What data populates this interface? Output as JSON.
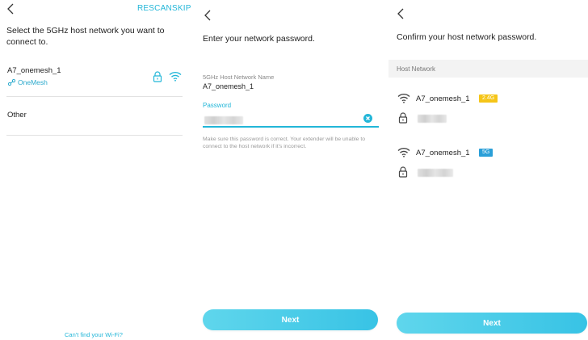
{
  "screen1": {
    "rescan_label": "RESCAN",
    "skip_label": "SKIP",
    "prompt": "Select the 5GHz host network you want to connect to.",
    "networks": [
      {
        "name": "A7_onemesh_1",
        "tag": "OneMesh"
      }
    ],
    "other_label": "Other",
    "cant_find_link": "Can't find your Wi-Fi?"
  },
  "screen2": {
    "prompt": "Enter your network password.",
    "host_name_label": "5GHz Host Network Name",
    "host_name_value": "A7_onemesh_1",
    "password_label": "Password",
    "helper_text": "Make sure this password is correct. Your extender will be unable to connect to the host network if it's incorrect.",
    "next_label": "Next"
  },
  "screen3": {
    "prompt": "Confirm your host network password.",
    "section_header": "Host Network",
    "entries": [
      {
        "name": "A7_onemesh_1",
        "band": "2.4G",
        "band_color": "#f5c518"
      },
      {
        "name": "A7_onemesh_1",
        "band": "5G",
        "band_color": "#2a9fd8"
      }
    ],
    "next_label": "Next"
  },
  "colors": {
    "accent": "#22b6d8",
    "button": "#38c3e5",
    "band_24": "#f5c518",
    "band_5": "#2a9fd8"
  },
  "icons": {
    "back": "chevron-left-icon",
    "lock": "lock-icon",
    "wifi": "wifi-icon",
    "mesh": "onemesh-icon",
    "clear": "clear-icon"
  }
}
